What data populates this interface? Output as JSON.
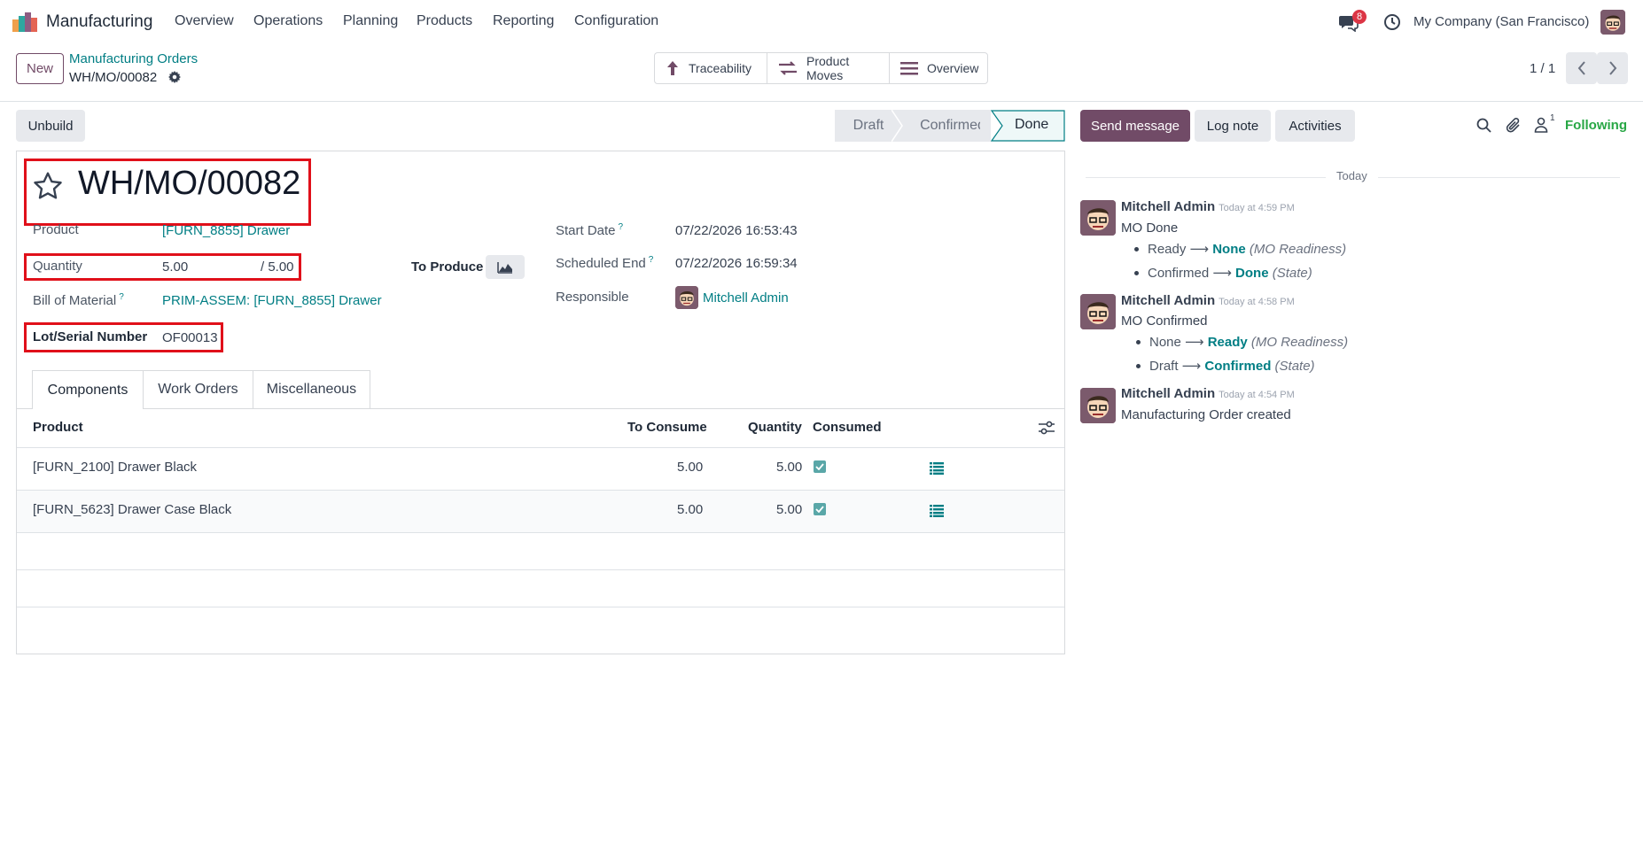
{
  "app": {
    "name": "Manufacturing"
  },
  "menu": [
    "Overview",
    "Operations",
    "Planning",
    "Products",
    "Reporting",
    "Configuration"
  ],
  "systray": {
    "messages_count": "8",
    "company": "My Company (San Francisco)"
  },
  "breadcrumb": {
    "parent": "Manufacturing Orders",
    "current": "WH/MO/00082"
  },
  "buttons": {
    "new": "New",
    "unbuild": "Unbuild"
  },
  "smart_buttons": {
    "traceability": "Traceability",
    "product_moves": "Product Moves",
    "overview": "Overview"
  },
  "pager": {
    "value": "1 / 1"
  },
  "statusbar": {
    "draft": "Draft",
    "confirmed": "Confirmed",
    "done": "Done",
    "active": "Done"
  },
  "record": {
    "name": "WH/MO/00082",
    "fields": {
      "product_label": "Product",
      "product_value": "[FURN_8855] Drawer",
      "quantity_label": "Quantity",
      "quantity_value": "5.00",
      "quantity_total": "/ 5.00",
      "to_produce_label": "To Produce",
      "bom_label": "Bill of Material",
      "bom_value": "PRIM-ASSEM: [FURN_8855] Drawer",
      "lot_label": "Lot/Serial Number",
      "lot_value": "OF00013",
      "start_date_label": "Start Date",
      "start_date_value": "07/22/2026 16:53:43",
      "scheduled_end_label": "Scheduled End",
      "scheduled_end_value": "07/22/2026 16:59:34",
      "responsible_label": "Responsible",
      "responsible_value": "Mitchell Admin",
      "help_mark": "?"
    }
  },
  "tabs": [
    "Components",
    "Work Orders",
    "Miscellaneous"
  ],
  "components_table": {
    "headers": {
      "product": "Product",
      "to_consume": "To Consume",
      "quantity": "Quantity",
      "consumed": "Consumed"
    },
    "rows": [
      {
        "product": "[FURN_2100] Drawer Black",
        "to_consume": "5.00",
        "quantity": "5.00",
        "consumed": true
      },
      {
        "product": "[FURN_5623] Drawer Case Black",
        "to_consume": "5.00",
        "quantity": "5.00",
        "consumed": true
      }
    ]
  },
  "chatter": {
    "send_message": "Send message",
    "log_note": "Log note",
    "activities": "Activities",
    "followers_count": "1",
    "following": "Following",
    "date_separator": "Today",
    "messages": [
      {
        "author": "Mitchell Admin",
        "time": "Today at 4:59 PM",
        "body": "MO Done",
        "tracking": [
          {
            "old": "Ready",
            "new": "None",
            "field": "(MO Readiness)"
          },
          {
            "old": "Confirmed",
            "new": "Done",
            "field": "(State)"
          }
        ]
      },
      {
        "author": "Mitchell Admin",
        "time": "Today at 4:58 PM",
        "body": "MO Confirmed",
        "tracking": [
          {
            "old": "None",
            "new": "Ready",
            "field": "(MO Readiness)"
          },
          {
            "old": "Draft",
            "new": "Confirmed",
            "field": "(State)"
          }
        ]
      },
      {
        "author": "Mitchell Admin",
        "time": "Today at 4:54 PM",
        "body": "Manufacturing Order created"
      }
    ]
  },
  "colors": {
    "accent": "#714b67",
    "link": "#017e84",
    "highlight": "#e0101a"
  }
}
